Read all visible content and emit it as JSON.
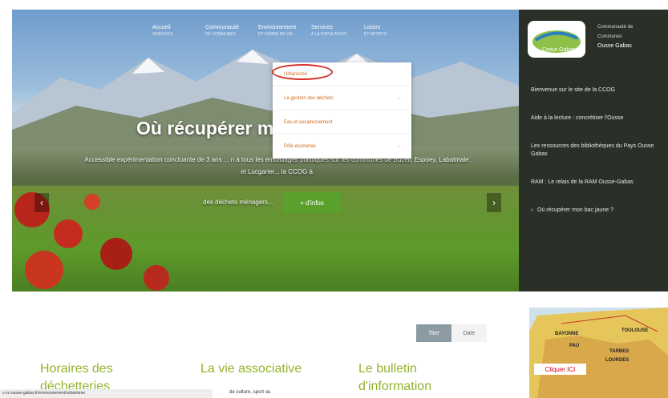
{
  "nav": [
    {
      "label": "Accueil",
      "sub": "SERVICES"
    },
    {
      "label": "Communauté",
      "sub": "DE COMMUNES"
    },
    {
      "label": "Environnement",
      "sub": "ET CADRE DE VIE"
    },
    {
      "label": "Services",
      "sub": "À LA POPULATION"
    },
    {
      "label": "Loisirs",
      "sub": "ET SPORTS"
    }
  ],
  "dropdown": [
    {
      "label": "Urbanisme"
    },
    {
      "label": "La gestion des déchets"
    },
    {
      "label": "Eau et assainissement"
    },
    {
      "label": "Pôle économie"
    }
  ],
  "hero": {
    "title": "Où récupérer m",
    "text": "Accessible expérimentation concluante de 3 ans ... n à tous les emballages plastiques sur les communes de Buzeil, Espoey, Labatmale et Lucgarier... la CCOG à",
    "small": "des déchets ménagers...",
    "more_label": "+ d'infos"
  },
  "sidebar": {
    "logo_text": "Coeur Gabas",
    "title_line1": "Communauté de",
    "title_line2": "Communes",
    "name": "Ousse Gabas",
    "items": [
      {
        "label": "Bienvenue sur le site de la CCOG"
      },
      {
        "label": "Aide à la lecture : concrétiser l'Ousse"
      },
      {
        "label": "Les ressources des bibliothèques du Pays Ousse Gabas"
      },
      {
        "label": "RAM : Le relais de la RAM Ousse-Gabas"
      },
      {
        "label": "Où récupérer mon bac jaune ?"
      }
    ]
  },
  "tabs": [
    {
      "label": "Titre"
    },
    {
      "label": "Date"
    }
  ],
  "columns": [
    {
      "title": "Horaires des",
      "title2": "déchetteries"
    },
    {
      "title": "La vie associative",
      "text": "de culture, sport ou"
    },
    {
      "title": "Le bulletin",
      "title2": "d'information"
    }
  ],
  "map": {
    "labels": [
      "BAYONNE",
      "TOULOUSE",
      "PAU",
      "TARBES",
      "LOURDES"
    ],
    "button": "Cliquer ICI"
  },
  "statusbar": "c-cc-ousse-gabas.fr/environnement/urbanisme"
}
